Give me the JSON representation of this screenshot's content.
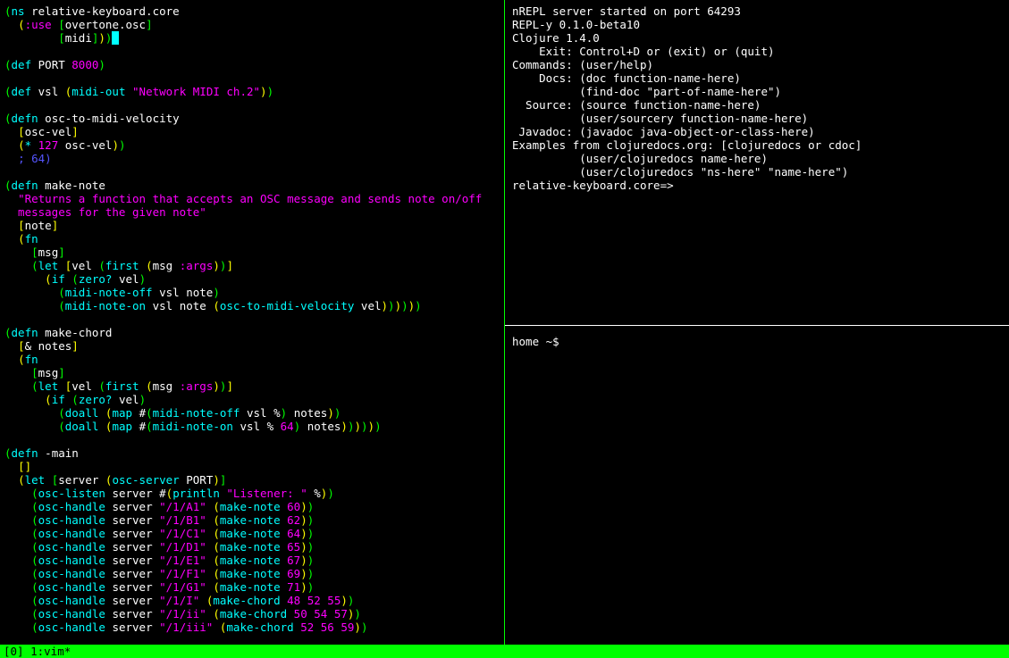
{
  "status_bar": "[0] 1:vim*",
  "shell_prompt": "home ~$ ",
  "repl": {
    "lines": [
      "nREPL server started on port 64293",
      "REPL-y 0.1.0-beta10",
      "Clojure 1.4.0",
      "    Exit: Control+D or (exit) or (quit)",
      "Commands: (user/help)",
      "    Docs: (doc function-name-here)",
      "          (find-doc \"part-of-name-here\")",
      "  Source: (source function-name-here)",
      "          (user/sourcery function-name-here)",
      " Javadoc: (javadoc java-object-or-class-here)",
      "Examples from clojuredocs.org: [clojuredocs or cdoc]",
      "          (user/clojuredocs name-here)",
      "          (user/clojuredocs \"ns-here\" \"name-here\")",
      "relative-keyboard.core=> "
    ]
  },
  "src": {
    "ns": "relative-keyboard.core",
    "use1": "overtone.osc",
    "use2": "midi",
    "port_sym": "PORT",
    "port_val": "8000",
    "vsl_sym": "vsl",
    "midi_out_fn": "midi-out",
    "midi_out_str": "\"Network MIDI ch.2\"",
    "fn1_name": "osc-to-midi-velocity",
    "fn1_arg": "osc-vel",
    "fn1_body_mul": "127",
    "fn1_comment": "; 64)",
    "fn2_name": "make-note",
    "fn2_doc": "\"Returns a function that accepts an OSC message and sends note on/off\n  messages for the given note\"",
    "fn2_arg": "note",
    "fn3_name": "make-chord",
    "fn3_arg": "& notes",
    "dovec": "doall",
    "map_fn": "map",
    "midi_off": "midi-note-off",
    "midi_on": "midi-note-on",
    "omv": "osc-to-midi-velocity",
    "zero": "zero?",
    "first": "first",
    "let": "let",
    "if": "if",
    "fn": "fn",
    "msg": "msg",
    "vel": "vel",
    "args": ":args",
    "sixtyfour": "64",
    "main_name": "-main",
    "osc_server": "osc-server",
    "osc_listen": "osc-listen",
    "osc_handle": "osc-handle",
    "println": "println",
    "listener_str": "\"Listener: \"",
    "make_note": "make-note",
    "make_chord": "make-chord",
    "routes": [
      {
        "path": "\"/1/A1\"",
        "call": "make-note",
        "args": "60"
      },
      {
        "path": "\"/1/B1\"",
        "call": "make-note",
        "args": "62"
      },
      {
        "path": "\"/1/C1\"",
        "call": "make-note",
        "args": "64"
      },
      {
        "path": "\"/1/D1\"",
        "call": "make-note",
        "args": "65"
      },
      {
        "path": "\"/1/E1\"",
        "call": "make-note",
        "args": "67"
      },
      {
        "path": "\"/1/F1\"",
        "call": "make-note",
        "args": "69"
      },
      {
        "path": "\"/1/G1\"",
        "call": "make-note",
        "args": "71"
      },
      {
        "path": "\"/1/I\"",
        "call": "make-chord",
        "args": "48 52 55"
      },
      {
        "path": "\"/1/ii\"",
        "call": "make-chord",
        "args": "50 54 57"
      },
      {
        "path": "\"/1/iii\"",
        "call": "make-chord",
        "args": "52 56 59"
      }
    ]
  }
}
